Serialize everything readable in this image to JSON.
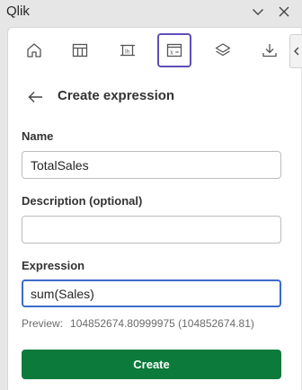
{
  "app": {
    "title": "Qlik"
  },
  "titlebar_icons": [
    "chevron-down-icon",
    "close-icon"
  ],
  "toolbar": {
    "tools": [
      {
        "name": "home-icon",
        "selected": false
      },
      {
        "name": "table-icon",
        "selected": false
      },
      {
        "name": "dimension-icon",
        "selected": false
      },
      {
        "name": "expression-icon",
        "selected": true
      },
      {
        "name": "layers-icon",
        "selected": false
      },
      {
        "name": "download-icon",
        "selected": false
      }
    ],
    "collapse_icon": "chevron-left-icon"
  },
  "header": {
    "back_icon": "arrow-left-icon",
    "title": "Create expression"
  },
  "form": {
    "name_label": "Name",
    "name_value": "TotalSales",
    "description_label": "Description (optional)",
    "description_value": "",
    "expression_label": "Expression",
    "expression_value": "sum(Sales)",
    "preview_label": "Preview:",
    "preview_value": "104852674.80999975 (104852674.81)",
    "create_label": "Create"
  },
  "colors": {
    "accent_selected": "#5e4fb9",
    "focus_border": "#3a6cc8",
    "create_button": "#0b7a3a"
  }
}
